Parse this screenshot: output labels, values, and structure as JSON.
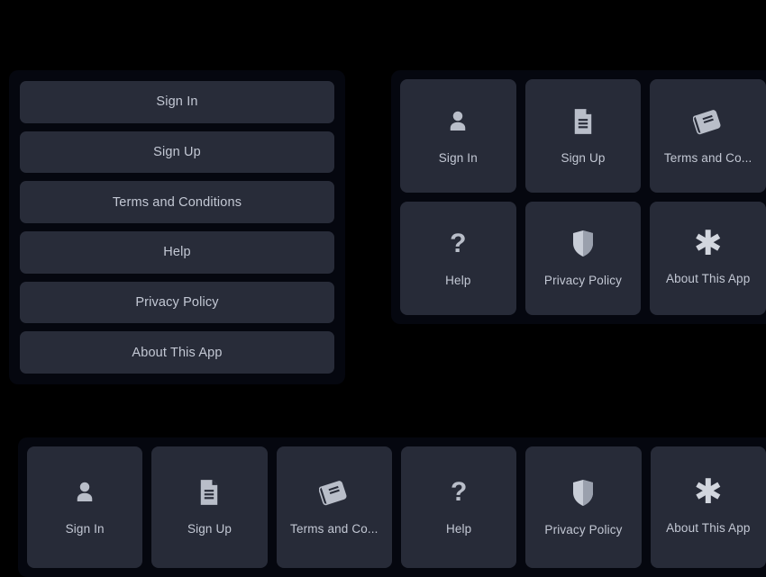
{
  "theme": {
    "page_background": "#000000",
    "panel_background": "#05070f",
    "tile_background": "#272b38",
    "label_color": "#c3c8d4",
    "icon_color": "#b9bec9"
  },
  "menu_items": [
    {
      "id": "sign-in",
      "label": "Sign In",
      "short_label": "Sign In",
      "icon": "user-icon"
    },
    {
      "id": "sign-up",
      "label": "Sign Up",
      "short_label": "Sign Up",
      "icon": "document-icon"
    },
    {
      "id": "terms-conditions",
      "label": "Terms and Conditions",
      "short_label": "Terms and Co...",
      "icon": "book-icon"
    },
    {
      "id": "help",
      "label": "Help",
      "short_label": "Help",
      "icon": "question-mark-icon"
    },
    {
      "id": "privacy-policy",
      "label": "Privacy Policy",
      "short_label": "Privacy Policy",
      "icon": "shield-icon"
    },
    {
      "id": "about-this-app",
      "label": "About This App",
      "short_label": "About This App",
      "icon": "asterisk-icon"
    }
  ],
  "list_panel": {
    "buttons": [
      {
        "label": "Sign In"
      },
      {
        "label": "Sign Up"
      },
      {
        "label": "Terms and Conditions"
      },
      {
        "label": "Help"
      },
      {
        "label": "Privacy Policy"
      },
      {
        "label": "About This App"
      }
    ]
  },
  "grid_panel": {
    "columns": 3,
    "rows": 2,
    "tiles": [
      {
        "label": "Sign In",
        "icon": "user-icon"
      },
      {
        "label": "Sign Up",
        "icon": "document-icon"
      },
      {
        "label": "Terms and Co...",
        "icon": "book-icon"
      },
      {
        "label": "Help",
        "icon": "question-mark-icon"
      },
      {
        "label": "Privacy Policy",
        "icon": "shield-icon"
      },
      {
        "label": "About This App",
        "icon": "asterisk-icon"
      }
    ]
  },
  "strip_panel": {
    "columns": 6,
    "rows": 1,
    "tiles": [
      {
        "label": "Sign In",
        "icon": "user-icon"
      },
      {
        "label": "Sign Up",
        "icon": "document-icon"
      },
      {
        "label": "Terms and Co...",
        "icon": "book-icon"
      },
      {
        "label": "Help",
        "icon": "question-mark-icon"
      },
      {
        "label": "Privacy Policy",
        "icon": "shield-icon"
      },
      {
        "label": "About This App",
        "icon": "asterisk-icon"
      }
    ]
  },
  "glyphs": {
    "question_mark": "?",
    "asterisk": "✱"
  }
}
